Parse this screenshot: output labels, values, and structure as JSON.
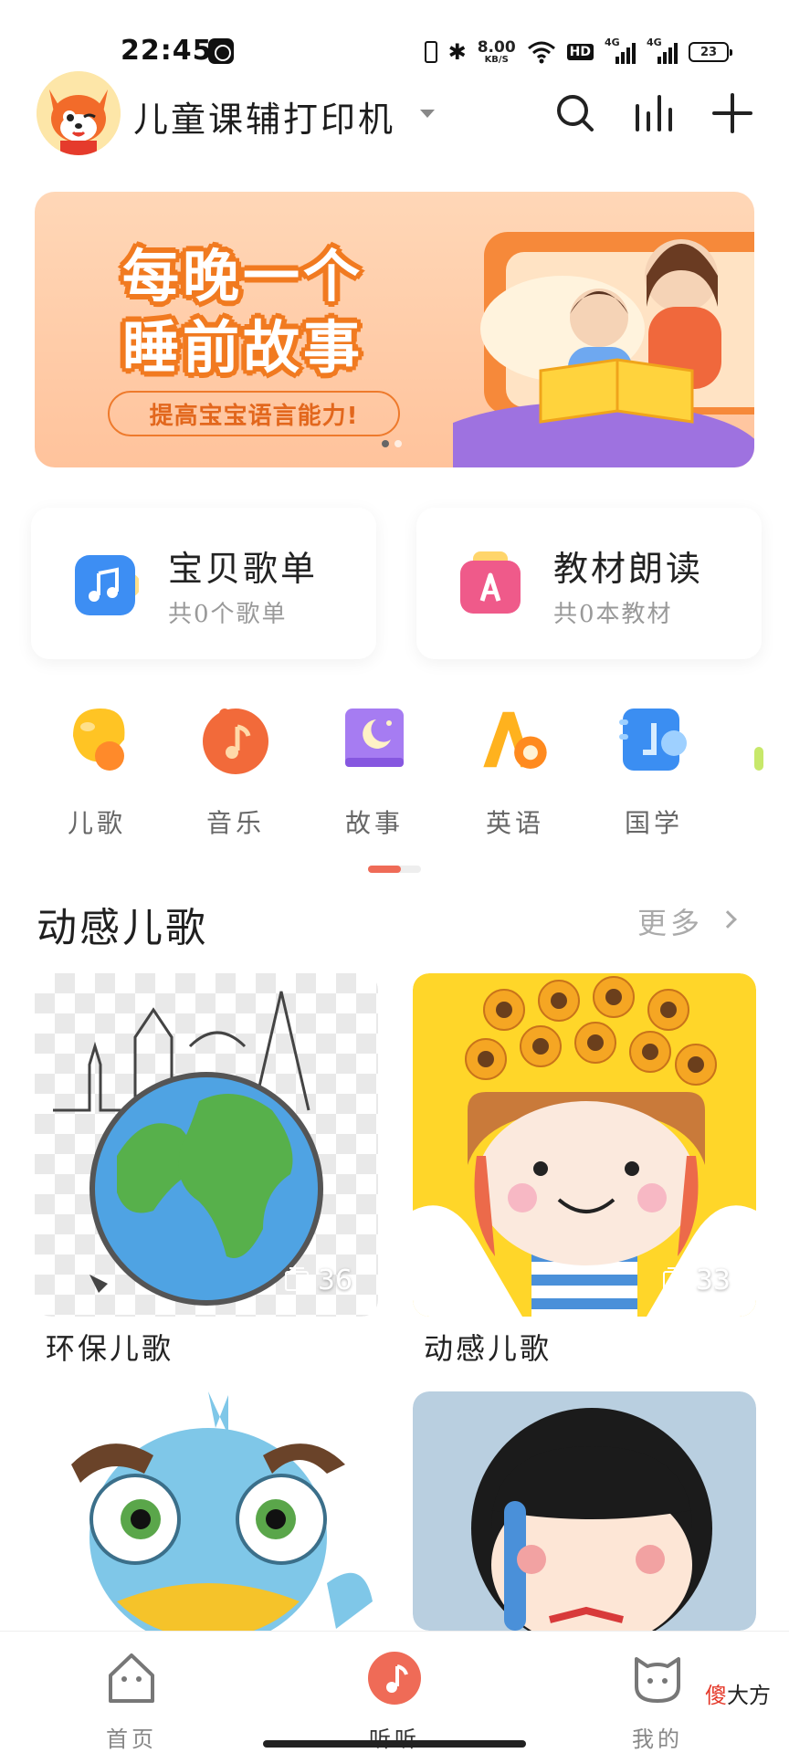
{
  "status_bar": {
    "time": "22:45",
    "net_speed_value": "8.00",
    "net_speed_unit": "KB/S",
    "hd_label": "HD",
    "signal_1_type": "4G",
    "signal_2_type": "4G",
    "battery_level": "23"
  },
  "header": {
    "device_name": "儿童课辅打印机",
    "icons": [
      "search-icon",
      "equalizer-icon",
      "add-icon"
    ]
  },
  "banner": {
    "title_line_1": "每晚一个",
    "title_line_2": "睡前故事",
    "subtitle": "提高宝宝语言能力!",
    "page_count": 2,
    "active_page": 1
  },
  "features": [
    {
      "title": "宝贝歌单",
      "subtitle": "共0个歌单",
      "icon": "music-note-icon",
      "color": "#3d8ef3"
    },
    {
      "title": "教材朗读",
      "subtitle": "共0本教材",
      "icon": "textbook-icon",
      "color": "#ef5a8a"
    }
  ],
  "categories": [
    {
      "label": "儿歌",
      "icon": "bell-icon"
    },
    {
      "label": "音乐",
      "icon": "music-disc-icon"
    },
    {
      "label": "故事",
      "icon": "moon-book-icon"
    },
    {
      "label": "英语",
      "icon": "letters-icon"
    },
    {
      "label": "国学",
      "icon": "scroll-book-icon"
    }
  ],
  "section": {
    "title": "动感儿歌",
    "more_label": "更多"
  },
  "albums": [
    {
      "name": "环保儿歌",
      "count": "36"
    },
    {
      "name": "动感儿歌",
      "count": "33"
    },
    {
      "name": "",
      "count": ""
    },
    {
      "name": "",
      "count": ""
    }
  ],
  "bottom_nav": [
    {
      "label": "首页",
      "icon": "home-icon"
    },
    {
      "label": "听听",
      "icon": "music-note-icon",
      "active": true
    },
    {
      "label": "我的",
      "icon": "profile-icon"
    }
  ],
  "watermark": {
    "highlight": "傻",
    "rest": "大方"
  },
  "colors": {
    "accent": "#ef6b57",
    "banner_orange": "#f17a20"
  }
}
